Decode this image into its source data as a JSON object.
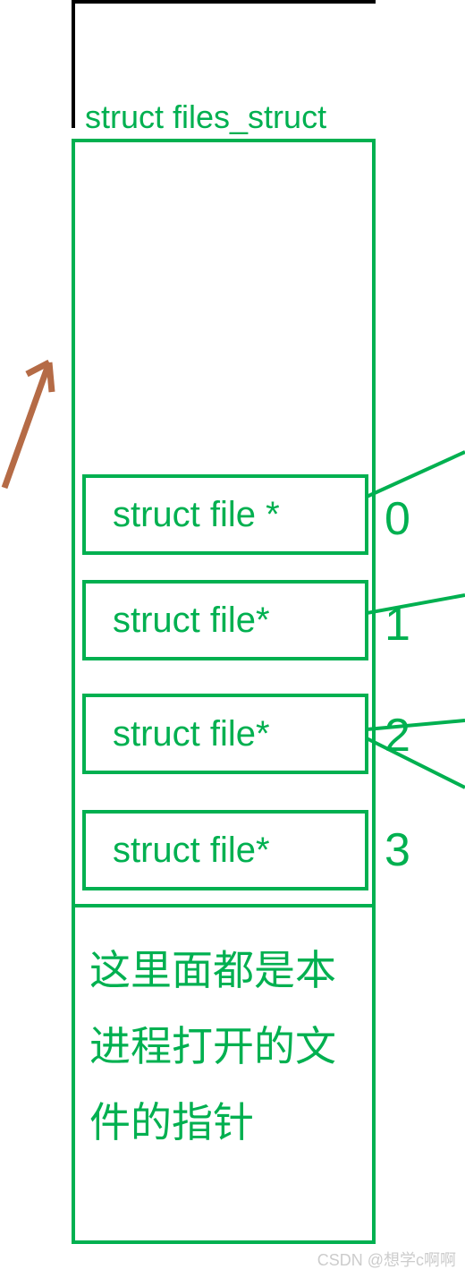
{
  "title": "struct files_struct",
  "rows": [
    {
      "label": "struct file *",
      "index": "0"
    },
    {
      "label": "struct file*",
      "index": "1"
    },
    {
      "label": "struct file*",
      "index": "2"
    },
    {
      "label": "struct file*",
      "index": "3"
    }
  ],
  "description": "这里面都是本进程打开的文件的指针",
  "watermark": "CSDN @想学c啊啊",
  "colors": {
    "green": "#00b050",
    "black": "#000000",
    "arrow": "#b56b46"
  }
}
